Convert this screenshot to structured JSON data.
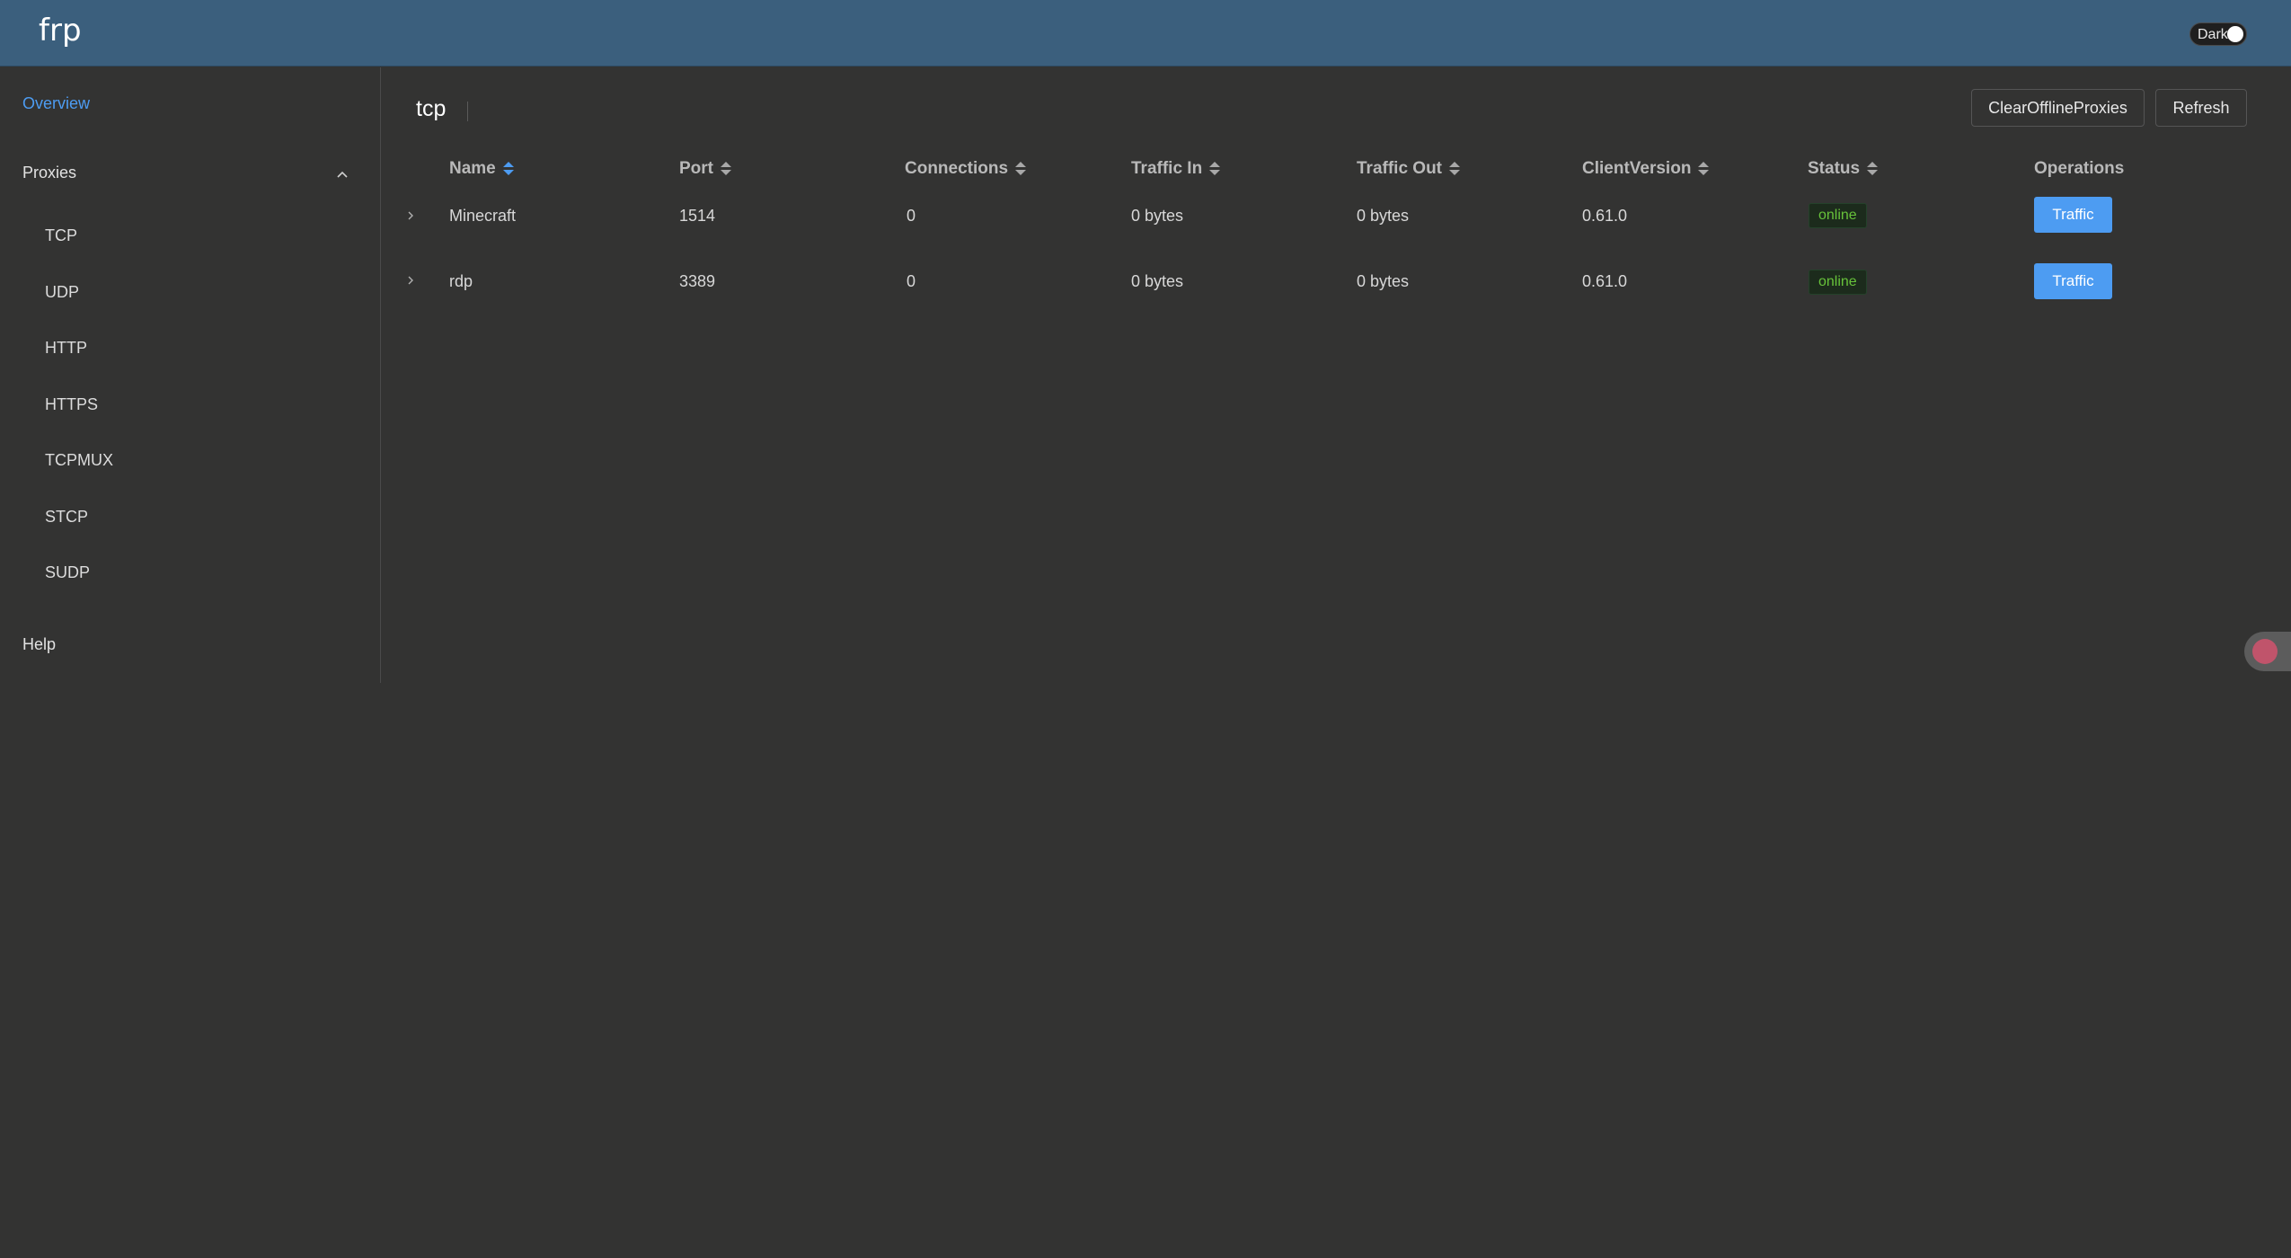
{
  "app": {
    "brand": "frp"
  },
  "theme_toggle": {
    "label": "Dark"
  },
  "sidebar": {
    "overview": "Overview",
    "proxies": "Proxies",
    "items": [
      {
        "label": "TCP"
      },
      {
        "label": "UDP"
      },
      {
        "label": "HTTP"
      },
      {
        "label": "HTTPS"
      },
      {
        "label": "TCPMUX"
      },
      {
        "label": "STCP"
      },
      {
        "label": "SUDP"
      }
    ],
    "help": "Help"
  },
  "main": {
    "title": "tcp",
    "buttons": {
      "clear_offline": "ClearOfflineProxies",
      "refresh": "Refresh"
    },
    "columns": [
      "Name",
      "Port",
      "Connections",
      "Traffic In",
      "Traffic Out",
      "ClientVersion",
      "Status",
      "Operations"
    ],
    "rows": [
      {
        "name": "Minecraft",
        "port": "1514",
        "connections": "0",
        "traffic_in": "0 bytes",
        "traffic_out": "0 bytes",
        "client_version": "0.61.0",
        "status": "online",
        "operation": "Traffic"
      },
      {
        "name": "rdp",
        "port": "3389",
        "connections": "0",
        "traffic_in": "0 bytes",
        "traffic_out": "0 bytes",
        "client_version": "0.61.0",
        "status": "online",
        "operation": "Traffic"
      }
    ]
  },
  "colors": {
    "header_bg": "#3b5f7d",
    "accent": "#4d9cf2",
    "online": "#67c23a",
    "page_bg": "#333332"
  },
  "icons": {
    "expand": "chevron-right-icon",
    "collapse": "chevron-up-icon",
    "sort": "sort-icon",
    "translate": "translate-icon"
  }
}
